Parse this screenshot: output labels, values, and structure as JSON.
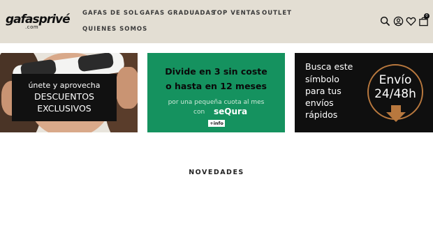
{
  "logo": {
    "wordmark": "gafasprivé",
    "sub": ".com"
  },
  "nav": [
    {
      "label": "GAFAS DE SOL"
    },
    {
      "label": "GAFAS GRADUADAS"
    },
    {
      "label": "TOP VENTAS"
    },
    {
      "label": "OUTLET"
    },
    {
      "label": "QUIENES SOMOS"
    }
  ],
  "header_icons": [
    "search-icon",
    "user-icon",
    "heart-icon",
    "bag-icon"
  ],
  "cart": {
    "count": "0"
  },
  "banners": {
    "discounts": {
      "line1": "únete y aprovecha",
      "line2": "DESCUENTOS",
      "line3": "EXCLUSIVOS"
    },
    "financing": {
      "line1": "Divide en 3 sin coste",
      "line2": "o hasta en 12 meses",
      "line3": "por una pequeña cuota al mes",
      "line4": "con",
      "brand": "seQura",
      "info": "+info"
    },
    "shipping": {
      "lines": [
        "Busca este",
        "símbolo",
        "para tus",
        "envíos",
        "rápidos"
      ],
      "badge1": "Envío",
      "badge2": "24/48h"
    }
  },
  "section": {
    "title": "NOVEDADES"
  },
  "colors": {
    "header_bg": "#e3ded3",
    "sequra_green": "#15925f",
    "shipping_accent": "#b8783e"
  }
}
